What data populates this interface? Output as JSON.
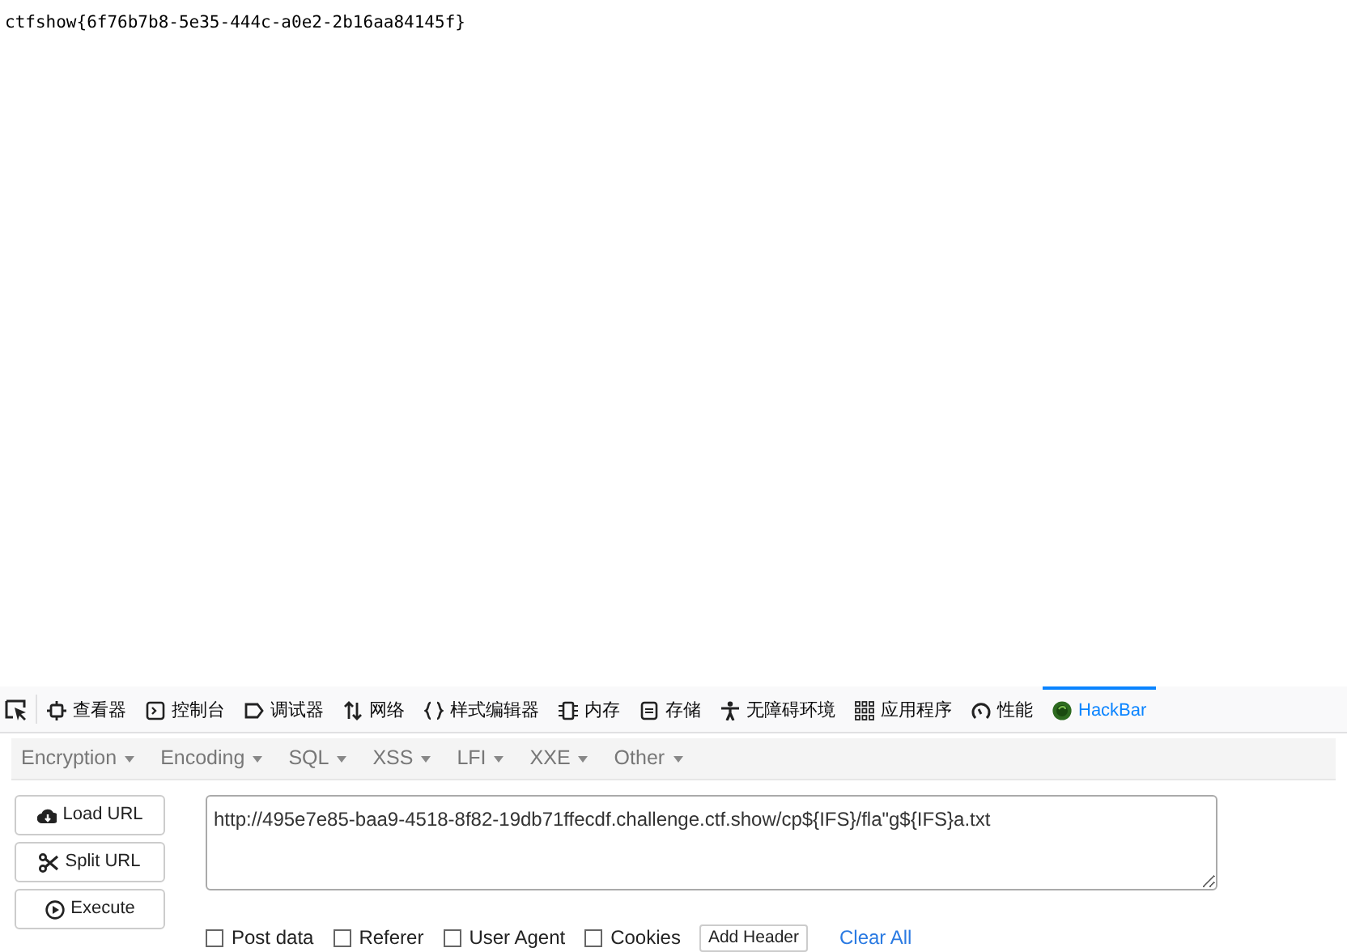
{
  "page": {
    "text": "ctfshow{6f76b7b8-5e35-444c-a0e2-2b16aa84145f}"
  },
  "devtools": {
    "tabs": [
      {
        "kind": "inspector",
        "label": "查看器",
        "selected": false
      },
      {
        "kind": "console",
        "label": "控制台",
        "selected": false
      },
      {
        "kind": "debugger",
        "label": "调试器",
        "selected": false
      },
      {
        "kind": "network",
        "label": "网络",
        "selected": false
      },
      {
        "kind": "style",
        "label": "样式编辑器",
        "selected": false
      },
      {
        "kind": "memory",
        "label": "内存",
        "selected": false
      },
      {
        "kind": "storage",
        "label": "存储",
        "selected": false
      },
      {
        "kind": "accessibility",
        "label": "无障碍环境",
        "selected": false
      },
      {
        "kind": "application",
        "label": "应用程序",
        "selected": false
      },
      {
        "kind": "performance",
        "label": "性能",
        "selected": false
      },
      {
        "kind": "hackbar",
        "label": "HackBar",
        "selected": true
      }
    ]
  },
  "hackbar": {
    "menus": [
      "Encryption",
      "Encoding",
      "SQL",
      "XSS",
      "LFI",
      "XXE",
      "Other"
    ],
    "buttons": [
      {
        "kind": "load",
        "label": "Load URL"
      },
      {
        "kind": "split",
        "label": "Split URL"
      },
      {
        "kind": "execute",
        "label": "Execute"
      }
    ],
    "url": "http://495e7e85-baa9-4518-8f82-19db71ffecdf.challenge.ctf.show/cp${IFS}/fla\"g${IFS}a.txt",
    "options": [
      {
        "label": "Post data",
        "checked": false
      },
      {
        "label": "Referer",
        "checked": false
      },
      {
        "label": "User Agent",
        "checked": false
      },
      {
        "label": "Cookies",
        "checked": false
      }
    ],
    "add_header": "Add Header",
    "clear_all": "Clear All"
  }
}
